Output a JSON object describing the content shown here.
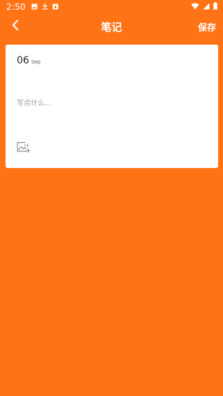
{
  "status_bar": {
    "time": "2:50",
    "notification_icons": [
      "gallery-icon",
      "download-icon",
      "app-notification-icon"
    ],
    "right_icons": [
      "wifi-icon",
      "signal-icon",
      "battery-icon"
    ]
  },
  "header": {
    "title": "笔记",
    "save_label": "保存",
    "back_icon": "back-arrow-icon"
  },
  "note": {
    "day": "06",
    "month": "Sep",
    "placeholder": "写点什么...",
    "value": "",
    "add_image_icon": "add-image-icon"
  },
  "colors": {
    "background": "#FF7317",
    "card": "#FFFFFF",
    "header_text": "#FFFFFF",
    "placeholder": "#9A9A9A"
  }
}
